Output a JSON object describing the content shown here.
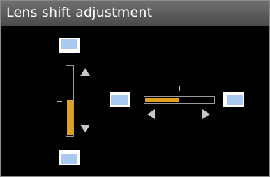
{
  "title": "Lens shift adjustment",
  "colors": {
    "accent": "#e0a020",
    "screen_fill": "#a9c9f0",
    "background": "#000000",
    "titlebar": "#5e5e5e"
  },
  "vertical_shift": {
    "level": 0.52
  },
  "horizontal_shift": {
    "level": 0.5
  },
  "icons": {
    "up": "triangle-up",
    "down": "triangle-down",
    "left": "triangle-left",
    "right": "triangle-right",
    "screen": "projection-screen"
  }
}
